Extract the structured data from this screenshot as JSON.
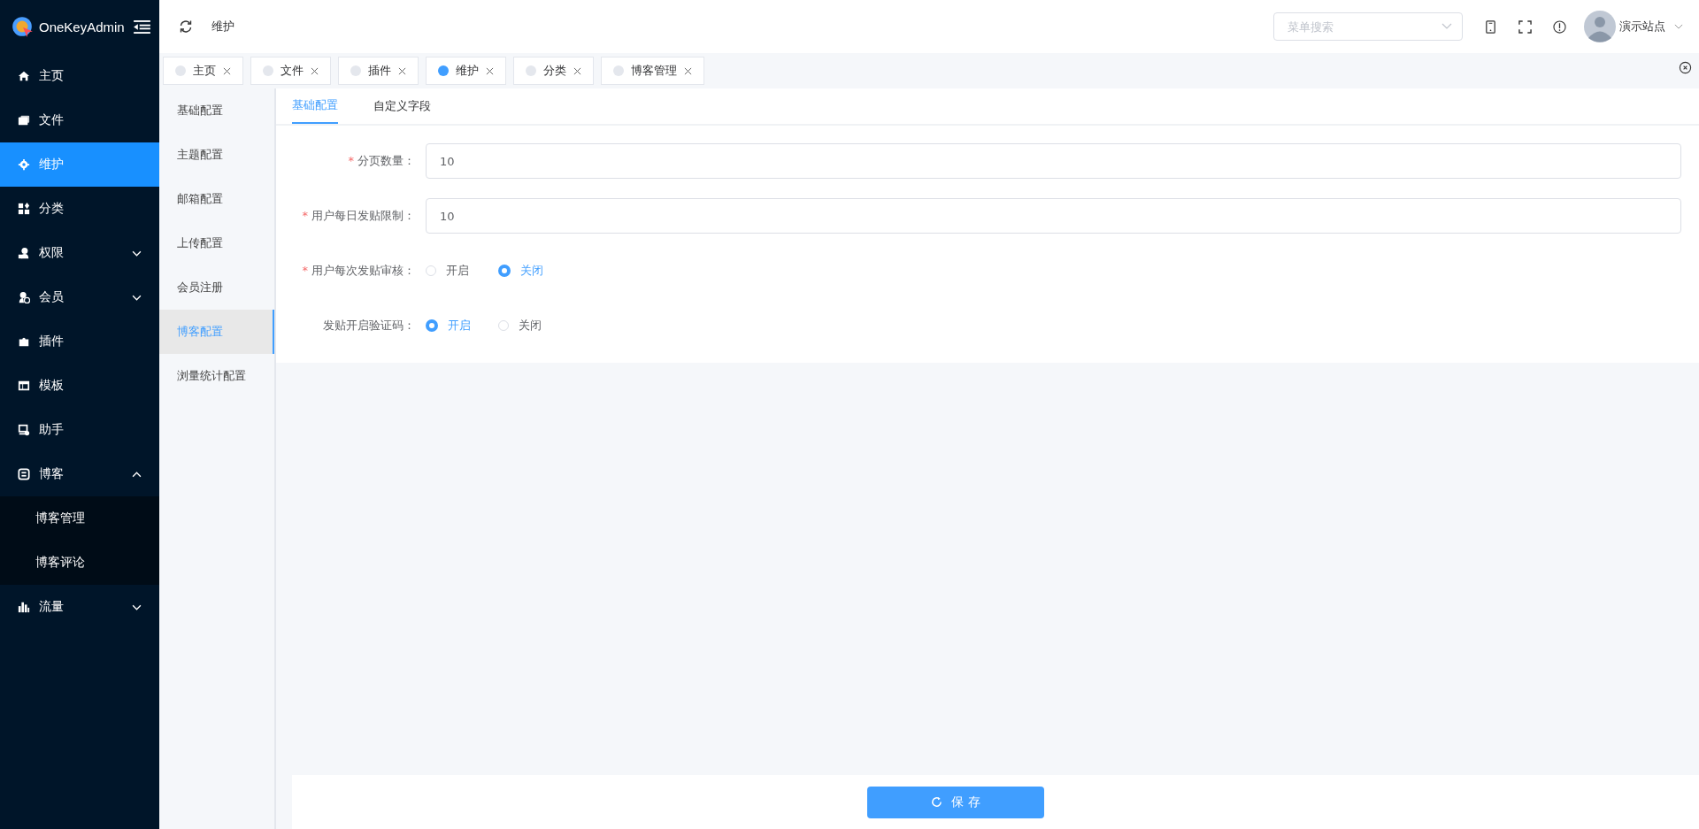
{
  "sidebar": {
    "logo": "OneKeyAdmin",
    "items": [
      {
        "label": "主页",
        "selected": false
      },
      {
        "label": "文件",
        "selected": false
      },
      {
        "label": "维护",
        "selected": true
      },
      {
        "label": "分类",
        "selected": false
      },
      {
        "label": "权限",
        "selected": false,
        "expanded": false
      },
      {
        "label": "会员",
        "selected": false,
        "expanded": false
      },
      {
        "label": "插件",
        "selected": false
      },
      {
        "label": "模板",
        "selected": false
      },
      {
        "label": "助手",
        "selected": false
      },
      {
        "label": "博客",
        "selected": false,
        "expanded": true,
        "children": [
          {
            "label": "博客管理",
            "selected": false
          },
          {
            "label": "博客评论",
            "selected": false
          }
        ]
      },
      {
        "label": "流量",
        "selected": false,
        "expanded": false
      }
    ]
  },
  "header": {
    "breadcrumb": "维护",
    "search": {
      "placeholder": "菜单搜索"
    },
    "user": "演示站点"
  },
  "tabs": [
    {
      "label": "主页",
      "selected": false
    },
    {
      "label": "文件",
      "selected": false
    },
    {
      "label": "插件",
      "selected": false
    },
    {
      "label": "维护",
      "selected": true
    },
    {
      "label": "分类",
      "selected": false
    },
    {
      "label": "博客管理",
      "selected": false
    }
  ],
  "settings_nav": [
    {
      "label": "基础配置",
      "selected": false
    },
    {
      "label": "主题配置",
      "selected": false
    },
    {
      "label": "邮箱配置",
      "selected": false
    },
    {
      "label": "上传配置",
      "selected": false
    },
    {
      "label": "会员注册",
      "selected": false
    },
    {
      "label": "博客配置",
      "selected": true
    },
    {
      "label": "浏量统计配置",
      "selected": false
    }
  ],
  "content_tabs": [
    {
      "label": "基础配置",
      "selected": true
    },
    {
      "label": "自定义字段",
      "selected": false
    }
  ],
  "form": [
    {
      "kind": "input",
      "required_mark": "*",
      "label": "分页数量：",
      "value": "10"
    },
    {
      "kind": "input",
      "required_mark": "*",
      "label": "用户每日发贴限制：",
      "value": "10"
    },
    {
      "kind": "radio",
      "required_mark": "*",
      "label": "用户每次发贴审核：",
      "options": [
        {
          "label": "开启",
          "selected": false
        },
        {
          "label": "关闭",
          "selected": true
        }
      ]
    },
    {
      "kind": "radio",
      "label": "发贴开启验证码：",
      "options": [
        {
          "label": "开启",
          "selected": true
        },
        {
          "label": "关闭",
          "selected": false
        }
      ]
    }
  ],
  "save_button": "保 存"
}
